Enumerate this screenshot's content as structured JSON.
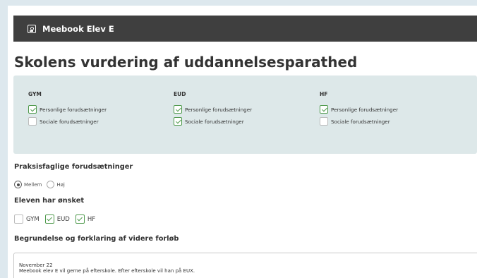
{
  "app": {
    "title": "Meebook Elev E"
  },
  "page": {
    "title": "Skolens vurdering af uddannelsesparathed"
  },
  "panel": {
    "columns": [
      {
        "heading": "GYM",
        "items": [
          {
            "label": "Personlige forudsætninger",
            "checked": true
          },
          {
            "label": "Sociale forudsætninger",
            "checked": false
          }
        ]
      },
      {
        "heading": "EUD",
        "items": [
          {
            "label": "Personlige forudsætninger",
            "checked": true
          },
          {
            "label": "Sociale forudsætninger",
            "checked": true
          }
        ]
      },
      {
        "heading": "HF",
        "items": [
          {
            "label": "Personlige forudsætninger",
            "checked": true
          },
          {
            "label": "Sociale forudsætninger",
            "checked": false
          }
        ]
      }
    ]
  },
  "praksis": {
    "label": "Praksisfaglige forudsætninger",
    "options": [
      "Mellem",
      "Høj"
    ],
    "selected": "Mellem"
  },
  "oensket": {
    "label": "Eleven har ønsket",
    "options": [
      {
        "label": "GYM",
        "checked": false
      },
      {
        "label": "EUD",
        "checked": true
      },
      {
        "label": "HF",
        "checked": true
      }
    ]
  },
  "begrundelse": {
    "label": "Begrundelse og forklaring af videre forløb",
    "line1": "November 22",
    "line2": "Meebook elev E vil gerne på efterskole. Efter efterskole vil han på EUX."
  },
  "colors": {
    "topbar": "#3f3f3f",
    "panel": "#dde8e9",
    "check": "#4f9a4d",
    "background": "#dde8ee"
  }
}
